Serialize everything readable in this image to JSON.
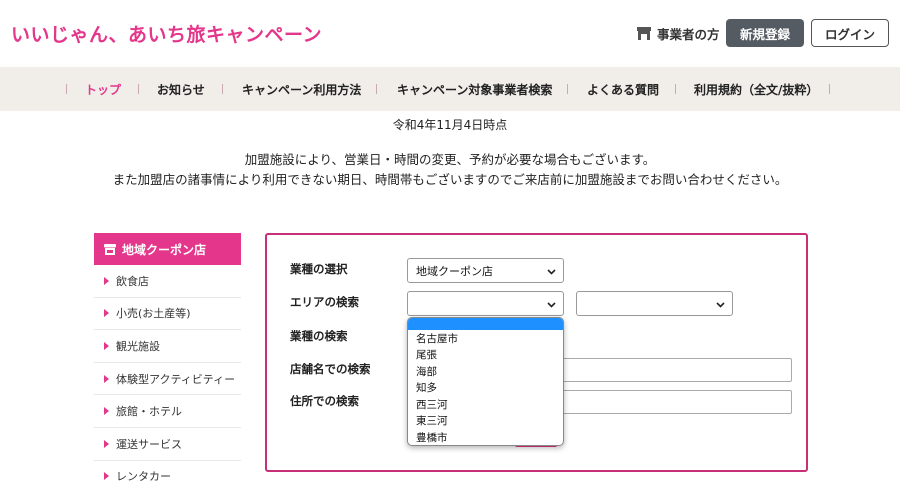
{
  "header": {
    "logo": "いいじゃん、あいち旅キャンペーン",
    "business_link": "事業者の方",
    "register_button": "新規登録",
    "login_button": "ログイン"
  },
  "nav": {
    "items": [
      {
        "label": "トップ",
        "active": true
      },
      {
        "label": "お知らせ"
      },
      {
        "label": "キャンペーン利用方法"
      },
      {
        "label": "キャンペーン対象事業者検索"
      },
      {
        "label": "よくある質問"
      },
      {
        "label": "利用規約（全文/抜粋）"
      }
    ]
  },
  "notice": {
    "date": "令和4年11月4日時点",
    "line1": "加盟施設により、営業日・時間の変更、予約が必要な場合もございます。",
    "line2": "また加盟店の諸事情により利用できない期日、時間帯もございますのでご来店前に加盟施設までお問い合わせください。"
  },
  "sidebar": {
    "header": "地域クーポン店",
    "items": [
      {
        "label": "飲食店"
      },
      {
        "label": "小売(お土産等)"
      },
      {
        "label": "観光施設"
      },
      {
        "label": "体験型アクティビティー"
      },
      {
        "label": "旅館・ホテル"
      },
      {
        "label": "運送サービス"
      },
      {
        "label": "レンタカー"
      }
    ]
  },
  "form": {
    "industry_label": "業種の選択",
    "industry_value": "地域クーポン店",
    "area_label": "エリアの検索",
    "area_value": "",
    "area_sub_value": "",
    "type_label": "業種の検索",
    "store_label": "店舗名での検索",
    "address_label": "住所での検索"
  },
  "area_dropdown": {
    "options": [
      "",
      "名古屋市",
      "尾張",
      "海部",
      "知多",
      "西三河",
      "東三河",
      "豊橋市"
    ]
  },
  "colors": {
    "brand_pink": "#e4368a",
    "panel_border": "#c72f77",
    "nav_bg": "#f1eeea",
    "register_bg": "#545b62",
    "highlight": "#1e90ff"
  }
}
